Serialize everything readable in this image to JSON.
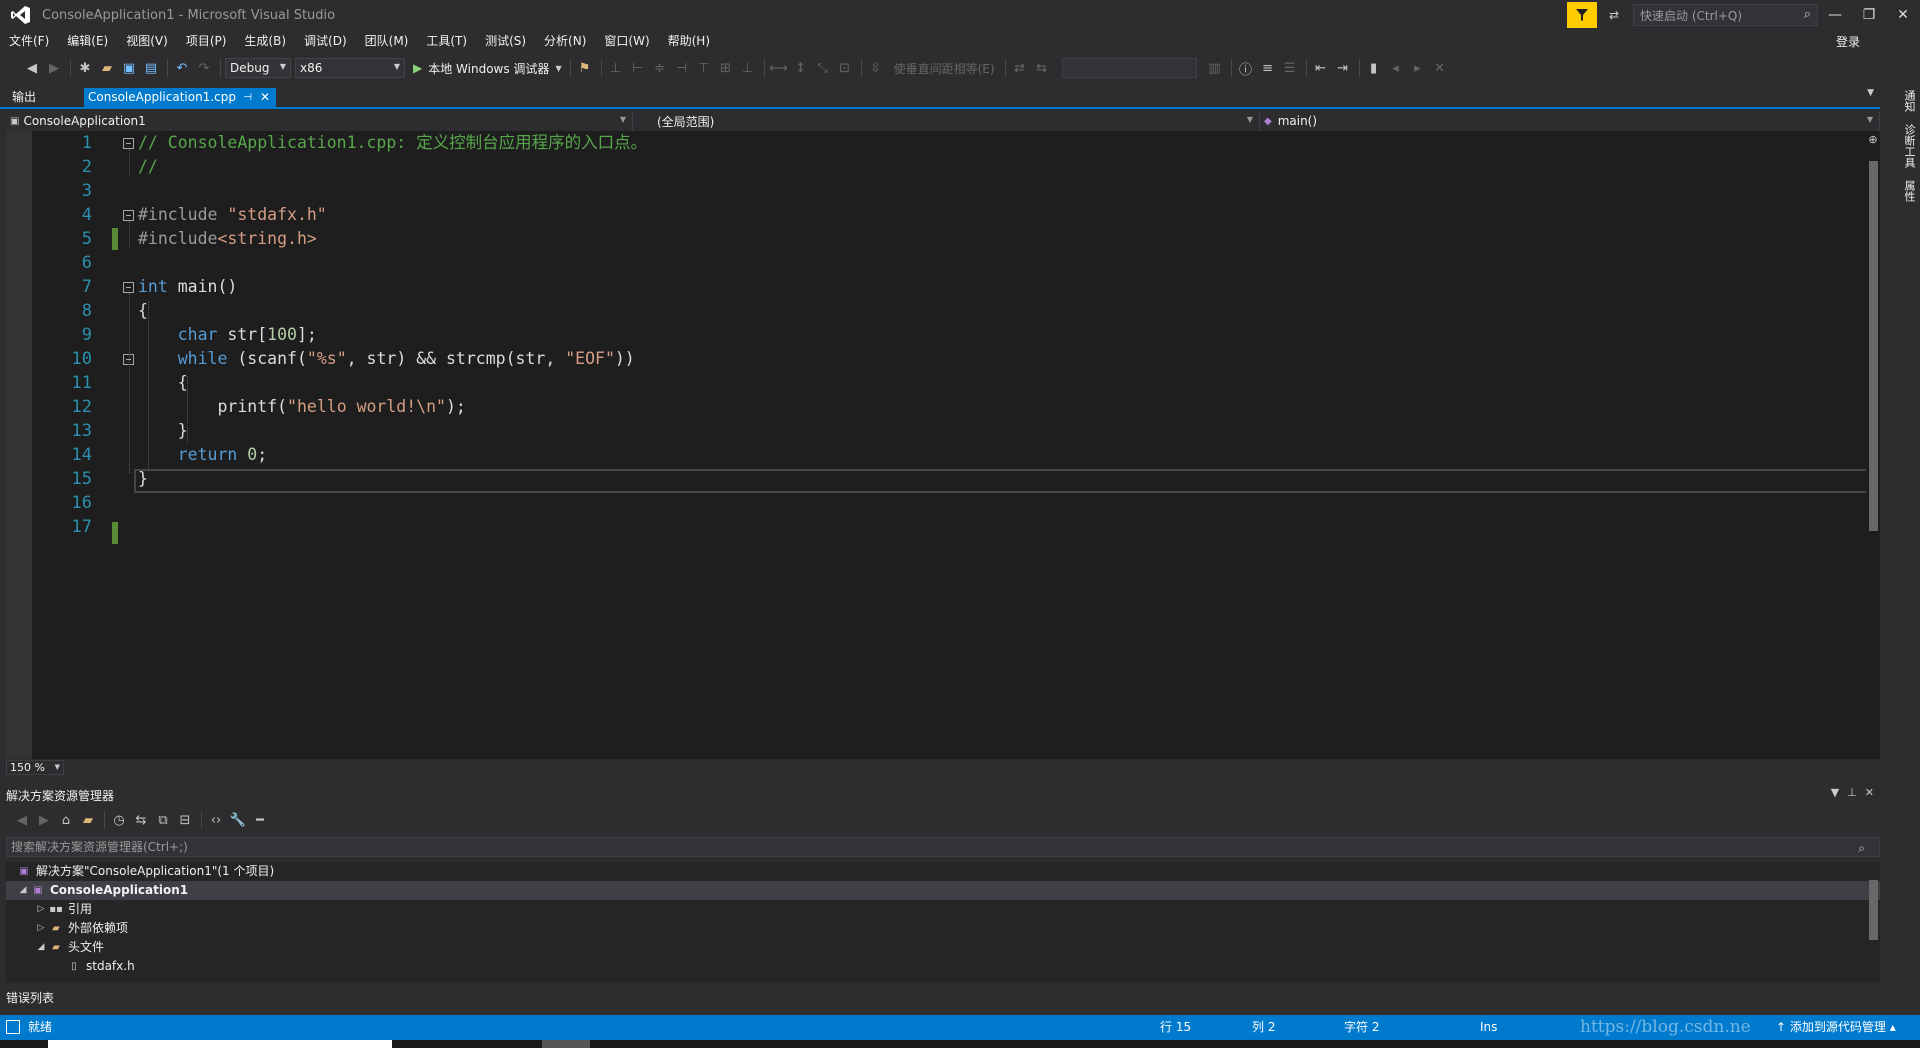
{
  "window": {
    "title": "ConsoleApplication1 - Microsoft Visual Studio",
    "quick_launch_placeholder": "快速启动 (Ctrl+Q)",
    "login": "登录"
  },
  "menu": [
    "文件(F)",
    "编辑(E)",
    "视图(V)",
    "项目(P)",
    "生成(B)",
    "调试(D)",
    "团队(M)",
    "工具(T)",
    "测试(S)",
    "分析(N)",
    "窗口(W)",
    "帮助(H)"
  ],
  "toolbar": {
    "config": "Debug",
    "platform": "x86",
    "run_label": "本地 Windows 调试器",
    "vertical_align_text": "使垂直间距相等(E)"
  },
  "tabs": {
    "output": "输出",
    "active_file": "ConsoleApplication1.cpp"
  },
  "navbar": {
    "project": "ConsoleApplication1",
    "scope": "(全局范围)",
    "member": "main()"
  },
  "editor": {
    "line_numbers": [
      "1",
      "2",
      "3",
      "4",
      "5",
      "6",
      "7",
      "8",
      "9",
      "10",
      "11",
      "12",
      "13",
      "14",
      "15",
      "16",
      "17"
    ],
    "zoom": "150 %",
    "code": {
      "l1": "// ConsoleApplication1.cpp: 定义控制台应用程序的入口点。",
      "l2": "//",
      "l4_directive": "#include ",
      "l4_file": "\"stdafx.h\"",
      "l5_directive": "#include",
      "l5_file": "<string.h>",
      "l7_kw": "int",
      "l7_rest": " main()",
      "l8": "{",
      "l9_kw": "char",
      "l9_mid": " str[",
      "l9_num": "100",
      "l9_end": "];",
      "l10_kw": "while",
      "l10_a": " (scanf(",
      "l10_s1": "\"%s\"",
      "l10_b": ", str) && strcmp(str, ",
      "l10_s2": "\"EOF\"",
      "l10_c": "))",
      "l11": "{",
      "l12_a": "printf(",
      "l12_s": "\"hello world!\\n\"",
      "l12_b": ");",
      "l13": "}",
      "l14_kw": "return",
      "l14_num": "0",
      "l14_end": ";",
      "l15": "}"
    }
  },
  "solution_explorer": {
    "title": "解决方案资源管理器",
    "search_placeholder": "搜索解决方案资源管理器(Ctrl+;)",
    "items": [
      {
        "label": "解决方案\"ConsoleApplication1\"(1 个项目)"
      },
      {
        "label": "ConsoleApplication1"
      },
      {
        "label": "引用"
      },
      {
        "label": "外部依赖项"
      },
      {
        "label": "头文件"
      },
      {
        "label": "stdafx.h"
      }
    ]
  },
  "error_list": "错误列表",
  "right_tabs": [
    "通知",
    "诊断工具",
    "属性"
  ],
  "status": {
    "ready": "就绪",
    "row": "行 15",
    "col": "列 2",
    "char": "字符 2",
    "ins": "Ins",
    "watermark": "https://blog.csdn.ne",
    "add_source": "添加到源代码管理"
  },
  "colors": {
    "accent": "#007acc",
    "editor_bg": "#1e1e1e",
    "chrome_bg": "#2d2d30",
    "comment": "#57a64a",
    "keyword": "#569cd6",
    "string": "#d69d85",
    "line_number": "#2b91af"
  }
}
